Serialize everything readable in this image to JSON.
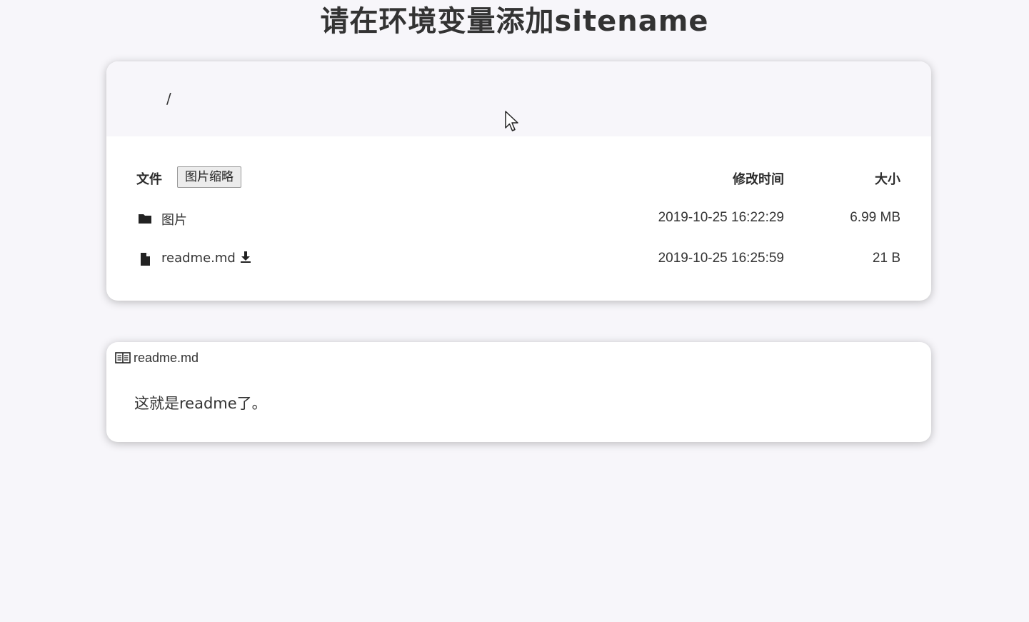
{
  "site": {
    "title": "请在环境变量添加sitename"
  },
  "path": {
    "current": "/"
  },
  "table": {
    "header": {
      "file": "文件",
      "thumbnail_button": "图片缩略",
      "mtime": "修改时间",
      "size": "大小"
    },
    "rows": [
      {
        "icon": "folder-icon",
        "name": "图片",
        "mtime": "2019-10-25 16:22:29",
        "size": "6.99 MB"
      },
      {
        "icon": "file-icon",
        "name": "readme.md",
        "mtime": "2019-10-25 16:25:59",
        "size": "21 B",
        "download_icon": "download-icon"
      }
    ]
  },
  "readme": {
    "icon": "book-icon",
    "filename": "readme.md",
    "content": "这就是readme了。"
  },
  "colors": {
    "background": "#f7f6fa",
    "card": "#ffffff",
    "text": "#333333"
  }
}
